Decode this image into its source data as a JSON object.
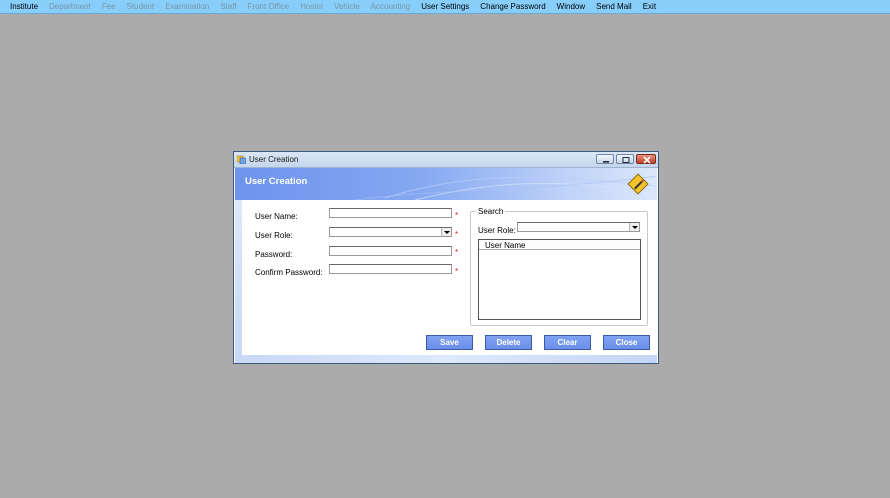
{
  "menubar": {
    "items": [
      {
        "label": "Institute",
        "enabled": true
      },
      {
        "label": "Department",
        "enabled": false
      },
      {
        "label": "Fee",
        "enabled": false
      },
      {
        "label": "Student",
        "enabled": false
      },
      {
        "label": "Examination",
        "enabled": false
      },
      {
        "label": "Staff",
        "enabled": false
      },
      {
        "label": "Front Office",
        "enabled": false
      },
      {
        "label": "Hostel",
        "enabled": false
      },
      {
        "label": "Vehicle",
        "enabled": false
      },
      {
        "label": "Accounting",
        "enabled": false
      },
      {
        "label": "User Settings",
        "enabled": true
      },
      {
        "label": "Change Password",
        "enabled": true
      },
      {
        "label": "Window",
        "enabled": true
      },
      {
        "label": "Send Mail",
        "enabled": true
      },
      {
        "label": "Exit",
        "enabled": true
      }
    ]
  },
  "window": {
    "title": "User Creation",
    "banner_title": "User Creation",
    "form": {
      "user_name_label": "User Name:",
      "user_name_value": "",
      "user_role_label": "User Role:",
      "user_role_value": "",
      "password_label": "Password:",
      "password_value": "",
      "confirm_password_label": "Confirm Password:",
      "confirm_password_value": "",
      "required_marker": "*"
    },
    "search": {
      "legend": "Search",
      "user_role_label": "User Role:",
      "user_role_value": "",
      "list_header": "User Name"
    },
    "buttons": {
      "save": "Save",
      "delete": "Delete",
      "clear": "Clear",
      "close": "Close"
    }
  },
  "colors": {
    "desktop": "#ababab",
    "menubar": "#87cefa",
    "banner": "#6d93ee",
    "button": "#7398ee",
    "required": "#e02020"
  }
}
